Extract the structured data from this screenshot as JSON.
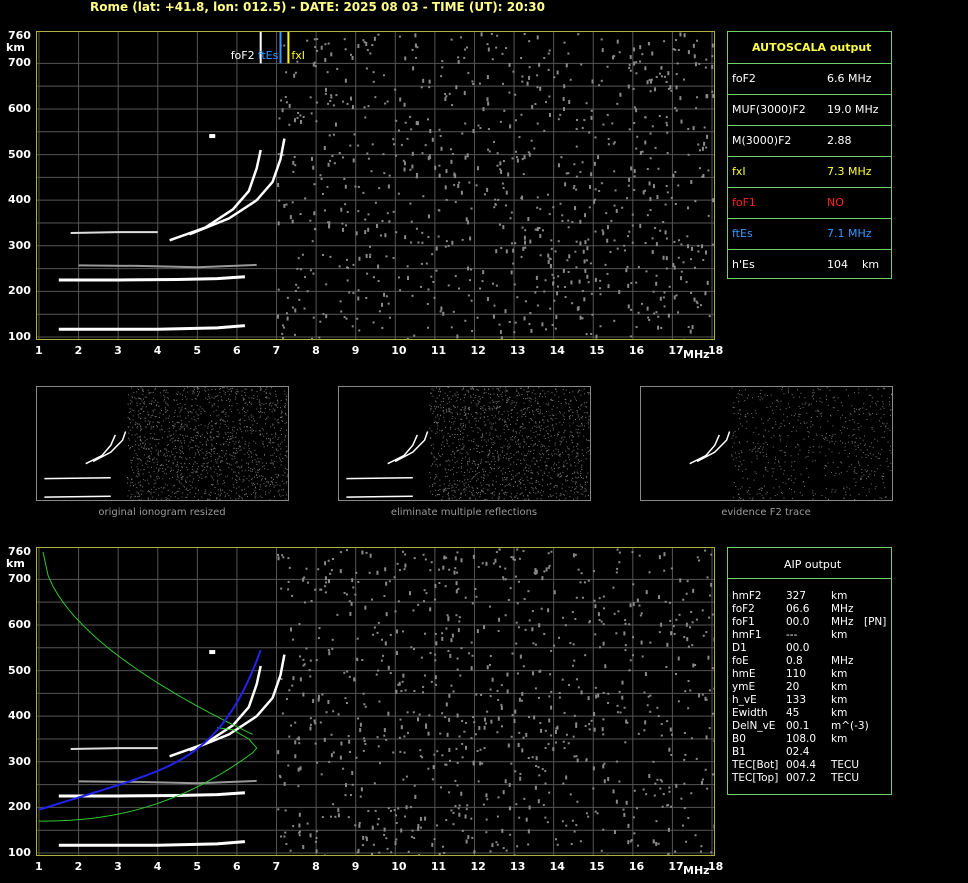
{
  "header": {
    "text": "Rome (lat: +41.8, lon: 012.5) - DATE: 2025 08 03 - TIME (UT): 20:30"
  },
  "axes": {
    "y_ticks": [
      "760",
      "700",
      "600",
      "500",
      "400",
      "300",
      "200",
      "100"
    ],
    "y_unit": "km",
    "x_ticks": [
      "1",
      "2",
      "3",
      "4",
      "5",
      "6",
      "7",
      "8",
      "9",
      "10",
      "11",
      "12",
      "13",
      "14",
      "15",
      "16",
      "17",
      "18"
    ],
    "x_unit": "MHz"
  },
  "top_plot": {
    "markers": {
      "foF2": "foF2",
      "ftEs": "ftEs",
      "fxI": "fxI"
    },
    "colors": {
      "frame": "#c8c83c",
      "grid": "#5a5a5a",
      "foF2": "#ffffff",
      "ftEs": "#3399ff",
      "fxI": "#ffff00"
    }
  },
  "autoscala": {
    "title": "AUTOSCALA output",
    "rows": [
      {
        "label": "foF2",
        "value": "6.6 MHz",
        "color": "#ffffff"
      },
      {
        "label": "MUF(3000)F2",
        "value": "19.0 MHz",
        "color": "#ffffff"
      },
      {
        "label": "M(3000)F2",
        "value": "2.88",
        "color": "#ffffff"
      },
      {
        "label": "fxI",
        "value": "7.3 MHz",
        "color": "#ffff44"
      },
      {
        "label": "foF1",
        "value": "NO",
        "color": "#ff2020"
      },
      {
        "label": "ftEs",
        "value": "7.1 MHz",
        "color": "#3399ff"
      },
      {
        "label": "h'Es",
        "value": "104    km",
        "color": "#ffffff"
      }
    ]
  },
  "thumbnails": [
    {
      "caption": "original ionogram resized"
    },
    {
      "caption": "eliminate multiple reflections"
    },
    {
      "caption": "evidence F2 trace"
    }
  ],
  "aip": {
    "title": "AIP output",
    "rows": [
      {
        "name": "hmF2",
        "value": "327",
        "unit": "km",
        "extra": ""
      },
      {
        "name": "foF2",
        "value": "06.6",
        "unit": "MHz",
        "extra": ""
      },
      {
        "name": "foF1",
        "value": "00.0",
        "unit": "MHz",
        "extra": "[PN]"
      },
      {
        "name": "hmF1",
        "value": "---",
        "unit": "km",
        "extra": ""
      },
      {
        "name": "D1",
        "value": "00.0",
        "unit": "",
        "extra": ""
      },
      {
        "name": "foE",
        "value": "0.8",
        "unit": "MHz",
        "extra": ""
      },
      {
        "name": "hmE",
        "value": "110",
        "unit": "km",
        "extra": ""
      },
      {
        "name": "ymE",
        "value": "20",
        "unit": "km",
        "extra": ""
      },
      {
        "name": "h_vE",
        "value": "133",
        "unit": "km",
        "extra": ""
      },
      {
        "name": "Ewidth",
        "value": "45",
        "unit": "km",
        "extra": ""
      },
      {
        "name": "DelN_vE",
        "value": "00.1",
        "unit": "m^(-3)",
        "extra": ""
      },
      {
        "name": "B0",
        "value": "108.0",
        "unit": "km",
        "extra": ""
      },
      {
        "name": "B1",
        "value": "02.4",
        "unit": "",
        "extra": ""
      },
      {
        "name": "TEC[Bot]",
        "value": "004.4",
        "unit": "TECU",
        "extra": ""
      },
      {
        "name": "TEC[Top]",
        "value": "007.2",
        "unit": "TECU",
        "extra": ""
      }
    ]
  }
}
